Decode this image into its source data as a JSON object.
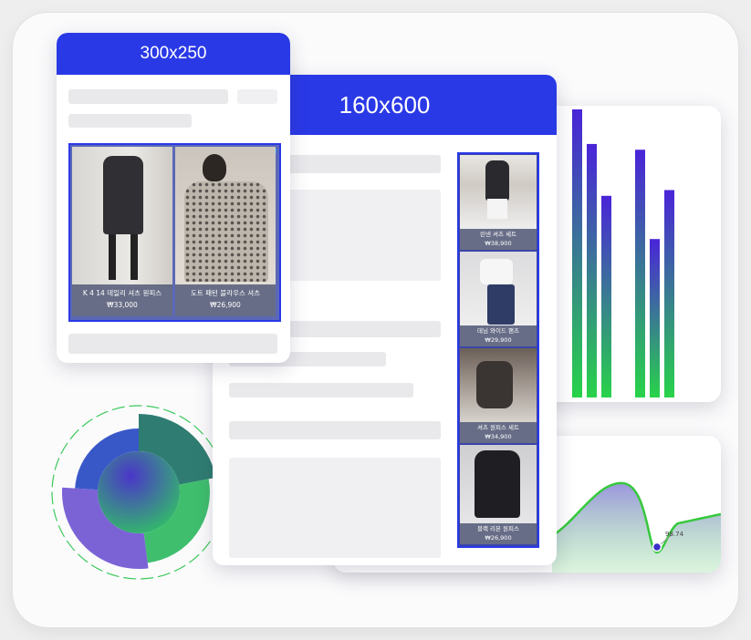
{
  "ads": {
    "medium_rectangle": {
      "size_label": "300x250",
      "products": [
        {
          "title": "K 4 14 데일리 셔츠 원피스",
          "price": "₩33,000"
        },
        {
          "title": "도트 패턴 블라우스 셔츠",
          "price": "₩26,900"
        }
      ]
    },
    "skyscraper": {
      "size_label": "160x600",
      "products": [
        {
          "title": "린넨 셔츠 세트",
          "price": "₩38,900"
        },
        {
          "title": "데님 와이드 팬츠",
          "price": "₩29,900"
        },
        {
          "title": "셔츠 원피스 세트",
          "price": "₩34,900"
        },
        {
          "title": "블랙 리본 원피스",
          "price": "₩26,900"
        }
      ]
    }
  },
  "bar_chart": {
    "values": [
      100,
      88,
      70,
      86,
      55,
      72
    ],
    "gradient": [
      "#4a24d9",
      "#28d34a"
    ]
  },
  "line_chart": {
    "marker_label": "98.74",
    "accent": "#36c93c"
  },
  "donut_chart": {
    "segments": [
      {
        "share": 0.22,
        "color": "#2f7d72"
      },
      {
        "share": 0.26,
        "color": "#3fbf6e"
      },
      {
        "share": 0.28,
        "color": "#7b63d6"
      },
      {
        "share": 0.24,
        "color": "#3958c8"
      }
    ]
  },
  "colors": {
    "brand_blue": "#2a39e6",
    "placeholder": "#e9e9ec",
    "frame": "#fbfbfc"
  }
}
